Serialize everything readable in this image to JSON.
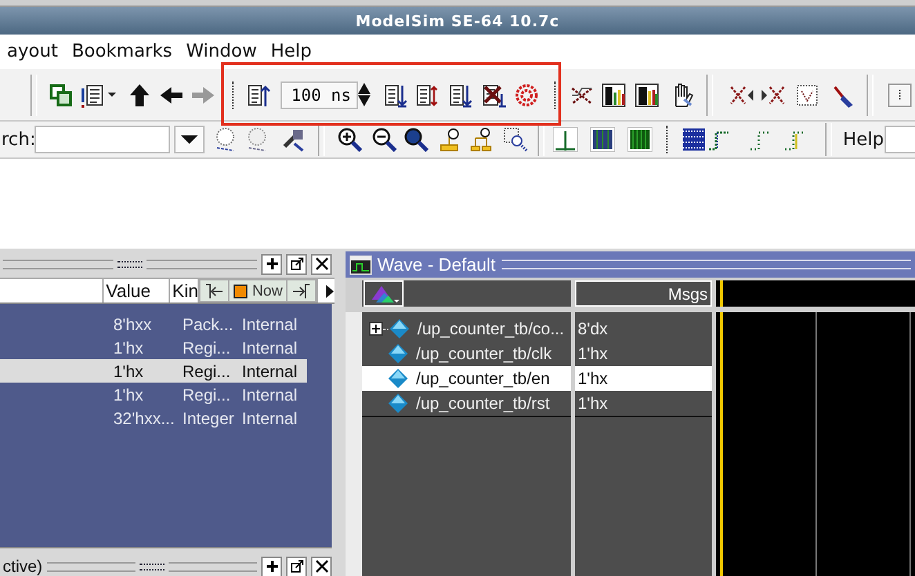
{
  "window": {
    "title": "ModelSim SE-64 10.7c"
  },
  "menu": [
    {
      "label": "ayout"
    },
    {
      "label": "Bookmarks"
    },
    {
      "label": "Window"
    },
    {
      "label": "Help"
    }
  ],
  "toolbar": {
    "time_field": {
      "value": "100 ns"
    }
  },
  "search": {
    "label": "rch:"
  },
  "help": {
    "label": "Help"
  },
  "highlight_box": true,
  "objects_panel": {
    "columns": [
      "Value",
      "Kin"
    ],
    "now_button": "Now",
    "rows": [
      {
        "value": "8'hxx",
        "kind": "Pack...",
        "mode": "Internal",
        "selected": false
      },
      {
        "value": "1'hx",
        "kind": "Regi...",
        "mode": "Internal",
        "selected": false
      },
      {
        "value": "1'hx",
        "kind": "Regi...",
        "mode": "Internal",
        "selected": true
      },
      {
        "value": "1'hx",
        "kind": "Regi...",
        "mode": "Internal",
        "selected": false
      },
      {
        "value": "32'hxx...",
        "kind": "Integer",
        "mode": "Internal",
        "selected": false
      }
    ]
  },
  "bottom_panel": {
    "title": "ctive)"
  },
  "wave": {
    "title": "Wave - Default",
    "msgs_header": "Msgs",
    "signals": [
      {
        "name": "/up_counter_tb/co...",
        "value": "8'dx",
        "expandable": true,
        "selected": false
      },
      {
        "name": "/up_counter_tb/clk",
        "value": "1'hx",
        "expandable": false,
        "selected": false
      },
      {
        "name": "/up_counter_tb/en",
        "value": "1'hx",
        "expandable": false,
        "selected": true
      },
      {
        "name": "/up_counter_tb/rst",
        "value": "1'hx",
        "expandable": false,
        "selected": false
      }
    ]
  }
}
